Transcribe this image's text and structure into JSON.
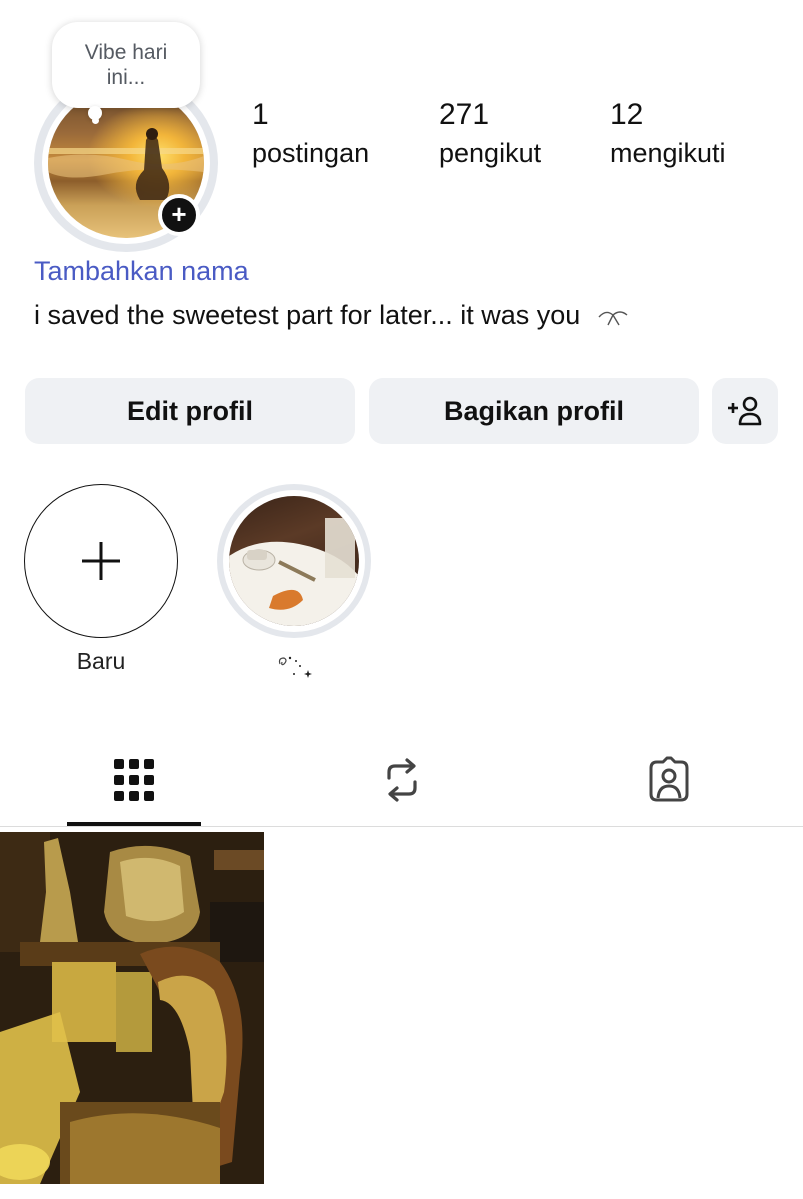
{
  "note": {
    "text_line1": "Vibe hari",
    "text_line2": "ini..."
  },
  "stats": [
    {
      "value": "1",
      "label": "postingan"
    },
    {
      "value": "271",
      "label": "pengikut"
    },
    {
      "value": "12",
      "label": "mengikuti"
    }
  ],
  "profile": {
    "add_name_link": "Tambahkan nama",
    "bio": "i saved the sweetest part for later... it was you"
  },
  "buttons": {
    "edit_profile": "Edit profil",
    "share_profile": "Bagikan profil"
  },
  "highlights": [
    {
      "label": "Baru"
    },
    {
      "label": ""
    }
  ],
  "icons": {
    "add_avatar": "plus-icon",
    "add_person": "add-person-icon",
    "new_highlight": "plus-icon",
    "grid_tab": "grid-icon",
    "reposts_tab": "repost-icon",
    "tagged_tab": "tagged-person-icon"
  },
  "colors": {
    "link": "#4a5bc4",
    "button_bg": "#eff1f4",
    "text": "#111111"
  }
}
